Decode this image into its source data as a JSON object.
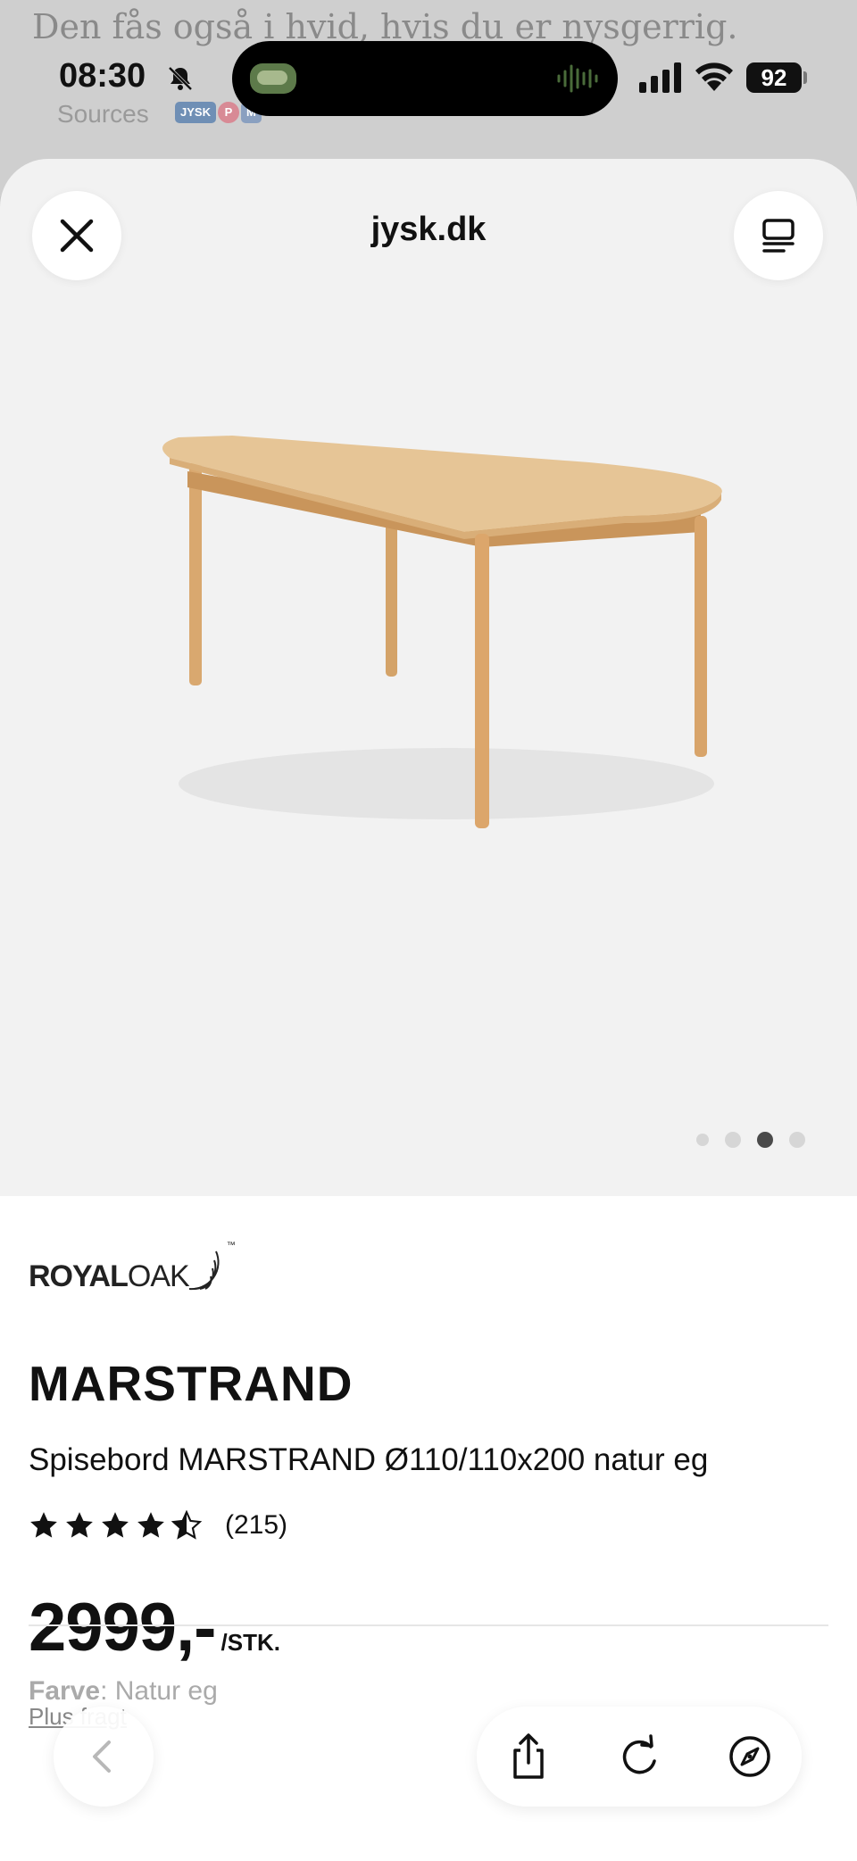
{
  "background_page": {
    "headline": "Den fås også i hvid, hvis du er nysgerrig.",
    "sources_label": "Sources",
    "source_logos": [
      "JYSK",
      "P",
      "M"
    ]
  },
  "status_bar": {
    "time": "08:30",
    "battery": "92",
    "icons": [
      "bell-slash-icon",
      "waveform-icon",
      "cellular-signal-icon",
      "wifi-icon",
      "battery-icon"
    ]
  },
  "sheet": {
    "title": "jysk.dk",
    "close_icon": "close-icon",
    "reader_icon": "reader-mode-icon"
  },
  "gallery": {
    "image_count": 4,
    "active_index": 2,
    "image_description_icon": "product-photo"
  },
  "product": {
    "brand": {
      "part1": "ROYAL",
      "part2": "OAK",
      "tm": "™"
    },
    "name": "MARSTRAND",
    "description": "Spisebord MARSTRAND Ø110/110x200 natur eg",
    "rating": 4.5,
    "review_count": "(215)",
    "price": "2999,-",
    "price_unit": "/STK.",
    "shipping_text": "Plus fragt",
    "color_label": "Farve",
    "color_value": ": Natur eg"
  },
  "toolbar": {
    "back_icon": "chevron-left-icon",
    "share_icon": "share-icon",
    "reload_icon": "reload-icon",
    "safari_icon": "compass-icon"
  }
}
